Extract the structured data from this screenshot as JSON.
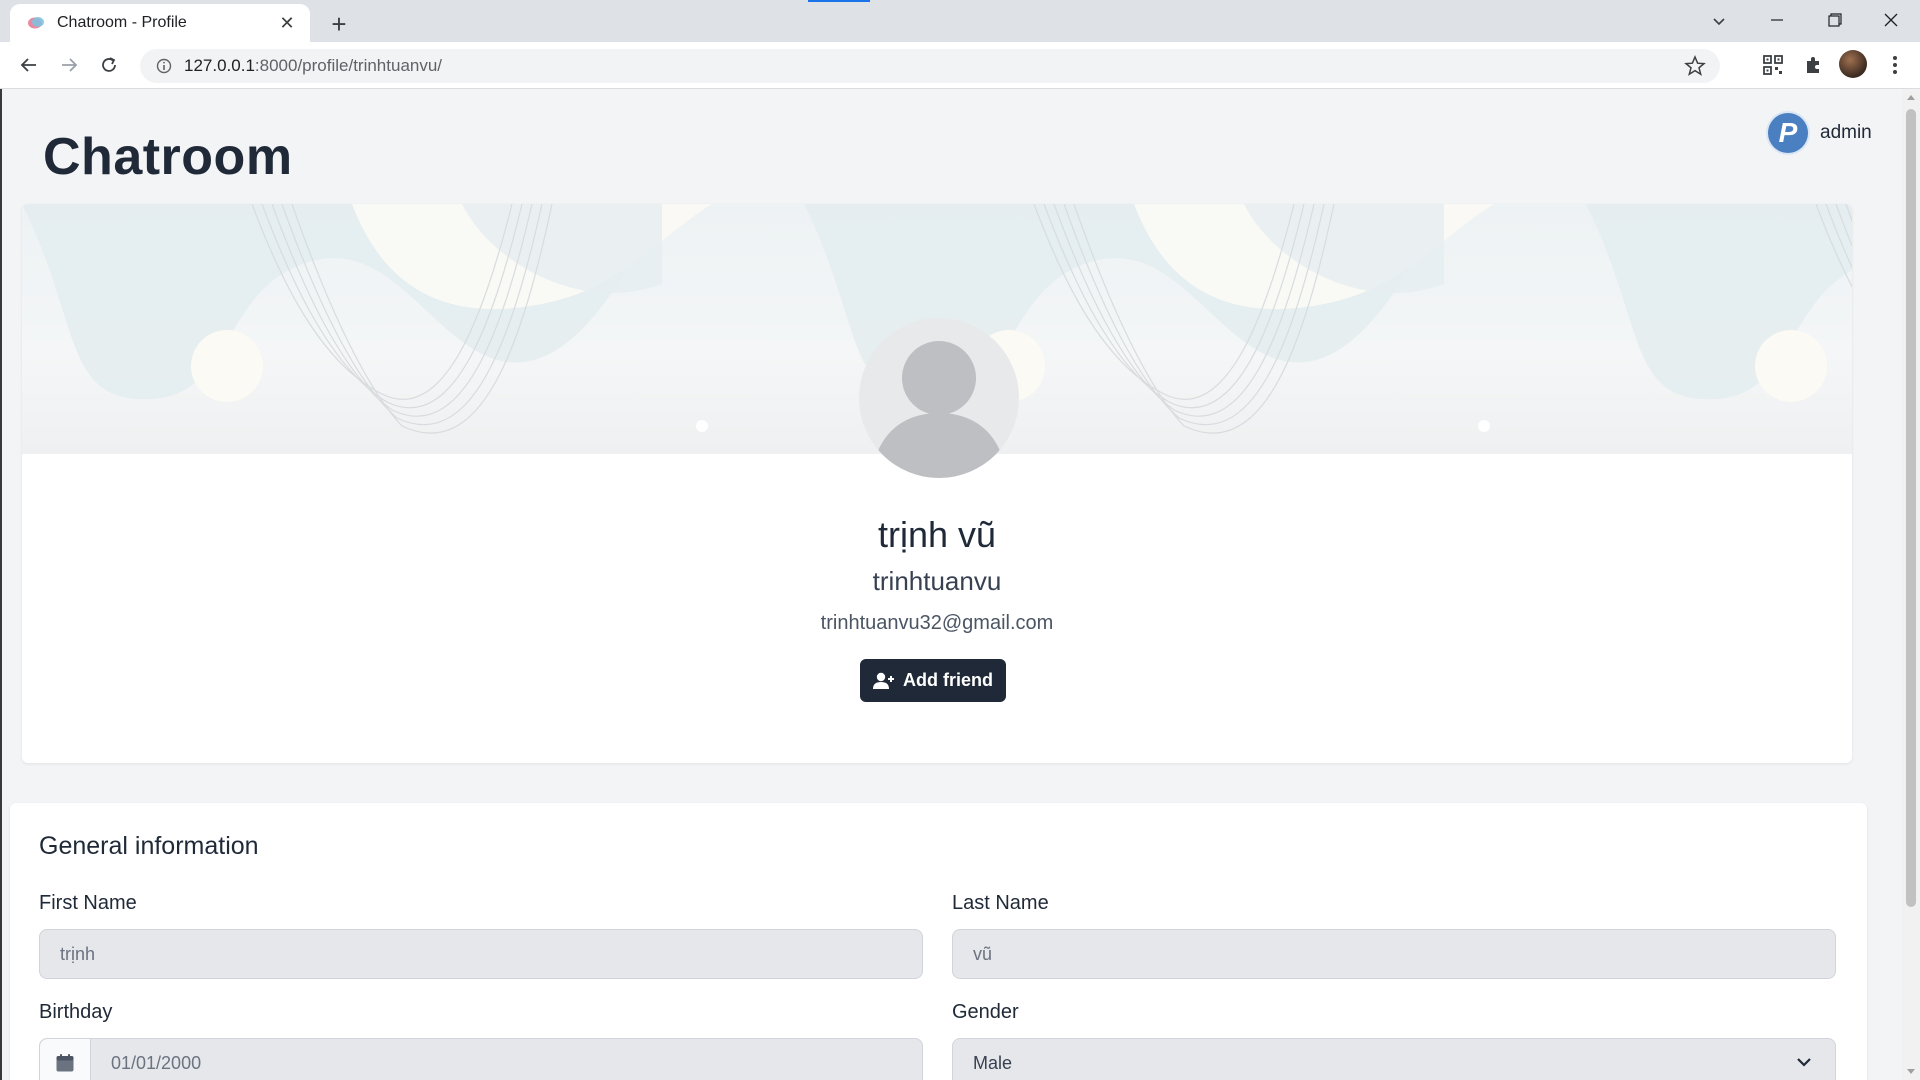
{
  "browser": {
    "tab_title": "Chatroom - Profile",
    "url_host": "127.0.0.1",
    "url_path": ":8000/profile/trinhtuanvu/"
  },
  "header": {
    "brand": "Chatroom",
    "user_initial": "P",
    "user_name": "admin"
  },
  "profile": {
    "display_name": "trịnh vũ",
    "username": "trinhtuanvu",
    "email": "trinhtuanvu32@gmail.com",
    "add_friend_label": "Add friend"
  },
  "general_info": {
    "title": "General information",
    "first_name_label": "First Name",
    "first_name_value": "trịnh",
    "last_name_label": "Last Name",
    "last_name_value": "vũ",
    "birthday_label": "Birthday",
    "birthday_value": "01/01/2000",
    "gender_label": "Gender",
    "gender_value": "Male"
  },
  "colors": {
    "accent": "#1f2937",
    "page_bg": "#f3f4f6",
    "input_bg": "#e5e7eb",
    "avatar_blue": "#4a7fc1"
  }
}
